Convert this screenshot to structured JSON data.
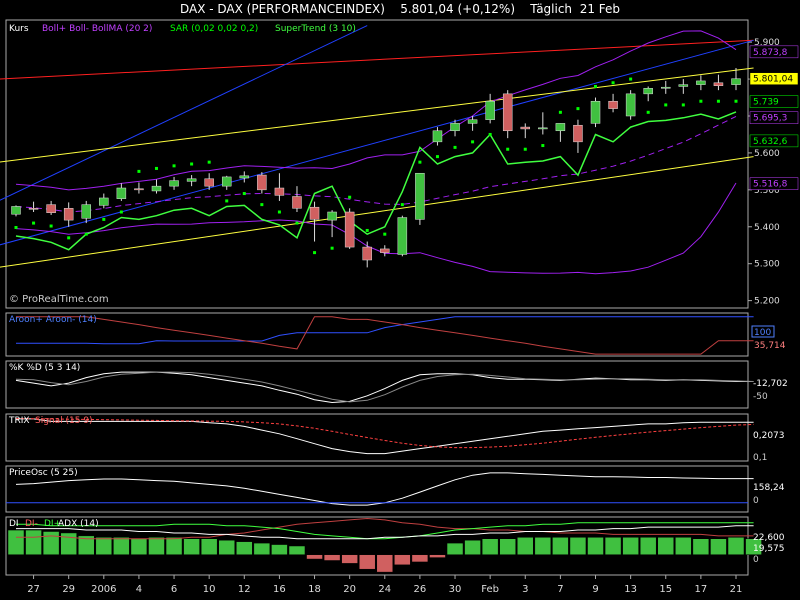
{
  "header": {
    "instrument": "DAX - DAX (PERFORMANCEINDEX)",
    "price_change": "5.801,04 (+0,12%)",
    "period": "Täglich",
    "date": "21 Feb"
  },
  "main_panel": {
    "legend": {
      "kurs": "Kurs",
      "boll": "Boll+ Boll- BollMA (20 2)",
      "sar": "SAR (0,02 0,02 0,2)",
      "supertrend": "SuperTrend (3 10)"
    },
    "watermark": "© ProRealTime.com",
    "value_labels": [
      {
        "text": "5.873,8",
        "value": 5873.8,
        "bg": "#000000",
        "fg": "#c040ff"
      },
      {
        "text": "5.801,04",
        "value": 5801.04,
        "bg": "#ffff00",
        "fg": "#000000"
      },
      {
        "text": "5.739",
        "value": 5739,
        "bg": "#000000",
        "fg": "#00ff00"
      },
      {
        "text": "5.695,3",
        "value": 5695.3,
        "bg": "#000000",
        "fg": "#c040ff"
      },
      {
        "text": "5.632,6",
        "value": 5632.6,
        "bg": "#000000",
        "fg": "#00ff00"
      },
      {
        "text": "5.516,8",
        "value": 5516.8,
        "bg": "#000000",
        "fg": "#c040ff"
      }
    ]
  },
  "aroon": {
    "legend": "Aroon+ Aroon- (14)",
    "labels": [
      "100",
      "35,714"
    ]
  },
  "stoch": {
    "legend": "%K %D (5 3 14)",
    "labels": [
      "-12,702",
      "-50"
    ]
  },
  "trix": {
    "legend_a": "TRIX",
    "legend_b": "Signal (15 9)",
    "labels": [
      "0,2073",
      "0,1"
    ]
  },
  "priceosc": {
    "legend": "PriceOsc (5 25)",
    "labels": [
      "158,24",
      "0"
    ]
  },
  "dmi": {
    "legend_a": "DI",
    "legend_b": "DI-",
    "legend_c": "DI+",
    "legend_d": "ADX (14)",
    "labels": [
      "22,600",
      "19,575",
      "0"
    ]
  },
  "chart_data": [
    {
      "type": "candlestick",
      "panel": "price",
      "ylim": [
        5180,
        5960
      ],
      "y_ticks": [
        {
          "value": 5900,
          "label": "5.900"
        },
        {
          "value": 5800,
          "label": "5.800"
        },
        {
          "value": 5700,
          "label": "5.700"
        },
        {
          "value": 5600,
          "label": "5.600"
        },
        {
          "value": 5500,
          "label": "5.500"
        },
        {
          "value": 5400,
          "label": "5.400"
        },
        {
          "value": 5300,
          "label": "5.300"
        },
        {
          "value": 5200,
          "label": "5.200"
        }
      ],
      "x_ticks": [
        "27",
        "29",
        "2006",
        "4",
        "6",
        "10",
        "12",
        "16",
        "18",
        "20",
        "24",
        "26",
        "30",
        "Feb",
        "3",
        "7",
        "9",
        "13",
        "15",
        "17",
        "21"
      ],
      "candles": [
        [
          5434,
          5458,
          5428,
          5455
        ],
        [
          5450,
          5468,
          5440,
          5448
        ],
        [
          5460,
          5470,
          5432,
          5438
        ],
        [
          5450,
          5466,
          5400,
          5418
        ],
        [
          5423,
          5470,
          5410,
          5460
        ],
        [
          5458,
          5490,
          5450,
          5478
        ],
        [
          5476,
          5518,
          5470,
          5505
        ],
        [
          5503,
          5520,
          5490,
          5500
        ],
        [
          5497,
          5528,
          5490,
          5510
        ],
        [
          5510,
          5535,
          5500,
          5525
        ],
        [
          5523,
          5540,
          5510,
          5530
        ],
        [
          5530,
          5545,
          5500,
          5510
        ],
        [
          5510,
          5538,
          5500,
          5535
        ],
        [
          5532,
          5550,
          5520,
          5538
        ],
        [
          5540,
          5548,
          5490,
          5500
        ],
        [
          5505,
          5545,
          5470,
          5485
        ],
        [
          5482,
          5510,
          5440,
          5450
        ],
        [
          5453,
          5468,
          5360,
          5420
        ],
        [
          5418,
          5445,
          5372,
          5440
        ],
        [
          5440,
          5450,
          5340,
          5345
        ],
        [
          5345,
          5360,
          5290,
          5310
        ],
        [
          5340,
          5350,
          5320,
          5330
        ],
        [
          5325,
          5430,
          5320,
          5425
        ],
        [
          5420,
          5545,
          5405,
          5545
        ],
        [
          5630,
          5670,
          5620,
          5660
        ],
        [
          5660,
          5690,
          5645,
          5680
        ],
        [
          5680,
          5700,
          5660,
          5690
        ],
        [
          5690,
          5760,
          5680,
          5740
        ],
        [
          5760,
          5770,
          5640,
          5660
        ],
        [
          5670,
          5680,
          5640,
          5665
        ],
        [
          5665,
          5710,
          5650,
          5668
        ],
        [
          5660,
          5680,
          5630,
          5680
        ],
        [
          5675,
          5690,
          5600,
          5630
        ],
        [
          5680,
          5750,
          5670,
          5740
        ],
        [
          5740,
          5760,
          5710,
          5720
        ],
        [
          5700,
          5770,
          5690,
          5760
        ],
        [
          5760,
          5780,
          5740,
          5775
        ],
        [
          5775,
          5795,
          5760,
          5778
        ],
        [
          5780,
          5800,
          5760,
          5785
        ],
        [
          5785,
          5810,
          5770,
          5795
        ],
        [
          5790,
          5812,
          5770,
          5782
        ],
        [
          5785,
          5830,
          5770,
          5801
        ]
      ]
    },
    {
      "type": "line",
      "panel": "aroon",
      "ylim": [
        -5,
        110
      ],
      "series": [
        {
          "name": "Aroon+",
          "values": [
            29,
            29,
            29,
            29,
            29,
            28,
            28,
            28,
            36,
            35,
            35,
            35,
            35,
            35,
            35,
            50,
            57,
            57,
            57,
            57,
            57,
            71,
            79,
            86,
            93,
            100,
            100,
            100,
            100,
            100,
            100,
            100,
            100,
            100,
            100,
            100,
            100,
            100,
            100,
            100,
            100,
            100,
            100
          ]
        },
        {
          "name": "Aroon-",
          "values": [
            100,
            100,
            100,
            100,
            100,
            93,
            86,
            79,
            71,
            64,
            57,
            50,
            43,
            36,
            29,
            21,
            14,
            100,
            100,
            93,
            93,
            86,
            79,
            71,
            64,
            57,
            50,
            43,
            36,
            29,
            21,
            14,
            7,
            0,
            0,
            0,
            0,
            0,
            0,
            0,
            36,
            36,
            36
          ]
        }
      ]
    },
    {
      "type": "line",
      "panel": "stoch",
      "ylim": [
        -60,
        25
      ],
      "series": [
        {
          "name": "%K",
          "values": [
            -10,
            -15,
            -20,
            -15,
            -5,
            2,
            5,
            5,
            5,
            3,
            0,
            -5,
            -10,
            -15,
            -20,
            -28,
            -35,
            -45,
            -50,
            -48,
            -38,
            -25,
            -10,
            0,
            2,
            2,
            0,
            -5,
            -8,
            -8,
            -9,
            -10,
            -8,
            -6,
            -7,
            -9,
            -9,
            -10,
            -9,
            -10,
            -11,
            -12,
            -12
          ]
        },
        {
          "name": "%D",
          "values": [
            -8,
            -9,
            -14,
            -18,
            -12,
            -4,
            1,
            3,
            5,
            5,
            4,
            1,
            -3,
            -8,
            -13,
            -20,
            -28,
            -36,
            -44,
            -49,
            -46,
            -36,
            -22,
            -10,
            -3,
            0,
            1,
            -1,
            -4,
            -7,
            -8,
            -9,
            -9,
            -8,
            -7,
            -7,
            -8,
            -9,
            -9,
            -9,
            -10,
            -11,
            -12
          ]
        }
      ]
    },
    {
      "type": "line",
      "panel": "trix",
      "ylim": [
        0.05,
        0.24
      ],
      "series": [
        {
          "name": "TRIX",
          "values": [
            0.22,
            0.22,
            0.21,
            0.21,
            0.21,
            0.21,
            0.21,
            0.21,
            0.21,
            0.21,
            0.21,
            0.205,
            0.2,
            0.19,
            0.175,
            0.16,
            0.14,
            0.12,
            0.1,
            0.088,
            0.08,
            0.08,
            0.09,
            0.1,
            0.11,
            0.12,
            0.13,
            0.14,
            0.15,
            0.16,
            0.17,
            0.175,
            0.18,
            0.185,
            0.19,
            0.195,
            0.2,
            0.2,
            0.205,
            0.207,
            0.207,
            0.207,
            0.207
          ]
        },
        {
          "name": "Signal",
          "values": [
            0.222,
            0.221,
            0.22,
            0.219,
            0.218,
            0.217,
            0.216,
            0.215,
            0.214,
            0.213,
            0.212,
            0.211,
            0.21,
            0.208,
            0.205,
            0.2,
            0.192,
            0.182,
            0.17,
            0.157,
            0.145,
            0.133,
            0.122,
            0.113,
            0.107,
            0.104,
            0.104,
            0.106,
            0.11,
            0.116,
            0.122,
            0.13,
            0.138,
            0.146,
            0.153,
            0.16,
            0.167,
            0.173,
            0.179,
            0.185,
            0.19,
            0.195,
            0.198
          ]
        }
      ]
    },
    {
      "type": "line",
      "panel": "priceosc",
      "ylim": [
        -60,
        240
      ],
      "series": [
        {
          "name": "PriceOsc",
          "values": [
            120,
            125,
            135,
            145,
            150,
            155,
            155,
            150,
            145,
            140,
            130,
            120,
            110,
            95,
            75,
            55,
            35,
            15,
            -5,
            -15,
            -15,
            0,
            30,
            70,
            110,
            150,
            180,
            195,
            195,
            190,
            185,
            180,
            175,
            170,
            170,
            168,
            165,
            165,
            162,
            160,
            158,
            158,
            158
          ]
        }
      ]
    },
    {
      "type": "bar",
      "panel": "dmi",
      "ylim": [
        -14,
        26
      ],
      "values": [
        17,
        17,
        16,
        15,
        13,
        12,
        12,
        11,
        12,
        12,
        11,
        11,
        10,
        9,
        8,
        7,
        6,
        -3,
        -4,
        -6,
        -10,
        -12,
        -7,
        -5,
        -2,
        8,
        10,
        11,
        11,
        12,
        12,
        12,
        12,
        12,
        12,
        12,
        12,
        12,
        12,
        11,
        11,
        12,
        11
      ],
      "series": [
        {
          "name": "DI-",
          "values": [
            12,
            12,
            13,
            12,
            11,
            11,
            11,
            11,
            11,
            11,
            12,
            12,
            14,
            15,
            17,
            19,
            21,
            22,
            23,
            24,
            25,
            24,
            22,
            21,
            19,
            18,
            18,
            17,
            17,
            16,
            16,
            15,
            15,
            15,
            14,
            14,
            14,
            14,
            14,
            14,
            13,
            13,
            13
          ]
        },
        {
          "name": "DI+",
          "values": [
            21,
            21,
            20,
            20,
            20,
            20,
            20,
            20,
            20,
            21,
            21,
            21,
            20,
            20,
            19,
            18,
            16,
            14,
            13,
            12,
            11,
            11,
            12,
            13,
            15,
            17,
            18,
            19,
            20,
            20,
            21,
            21,
            22,
            22,
            22,
            22,
            22,
            22,
            22,
            22,
            22,
            22,
            22
          ]
        },
        {
          "name": "ADX",
          "values": [
            18,
            18,
            18,
            18,
            17,
            17,
            17,
            16,
            16,
            15,
            15,
            14,
            14,
            13,
            12,
            12,
            11,
            11,
            11,
            11,
            11,
            12,
            12,
            13,
            13,
            14,
            14,
            15,
            15,
            16,
            16,
            16,
            17,
            17,
            18,
            18,
            19,
            19,
            19,
            19,
            19,
            20,
            20
          ]
        }
      ]
    }
  ]
}
